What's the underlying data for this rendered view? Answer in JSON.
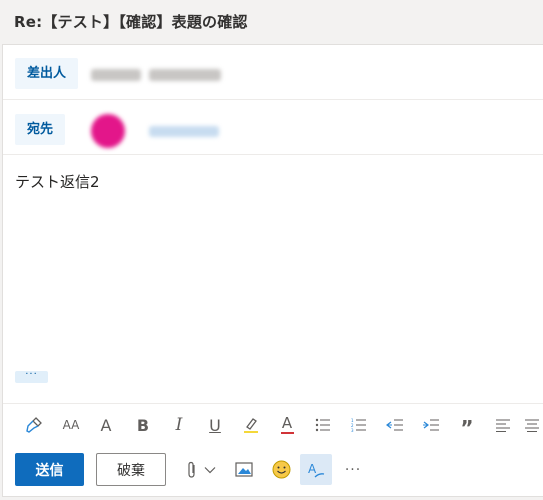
{
  "subject": "Re:【テスト】【確認】表題の確認",
  "from": {
    "label": "差出人"
  },
  "to": {
    "label": "宛先"
  },
  "body": {
    "text": "テスト返信2"
  },
  "quoted_toggle": "···",
  "format_toolbar": {
    "font_size_label": "AA",
    "grow_font_label": "A",
    "bold_label": "B",
    "italic_label": "I",
    "underline_label": "U",
    "font_color_label": "A",
    "quote_label": "”"
  },
  "actions": {
    "send_label": "送信",
    "discard_label": "破棄",
    "more_label": "···"
  },
  "colors": {
    "accent": "#0f6cbd",
    "field_button_bg": "#eff6fc",
    "highlight_yellow": "#f4d83a",
    "font_color_red": "#d13438",
    "emoji_yellow": "#f7c948"
  }
}
